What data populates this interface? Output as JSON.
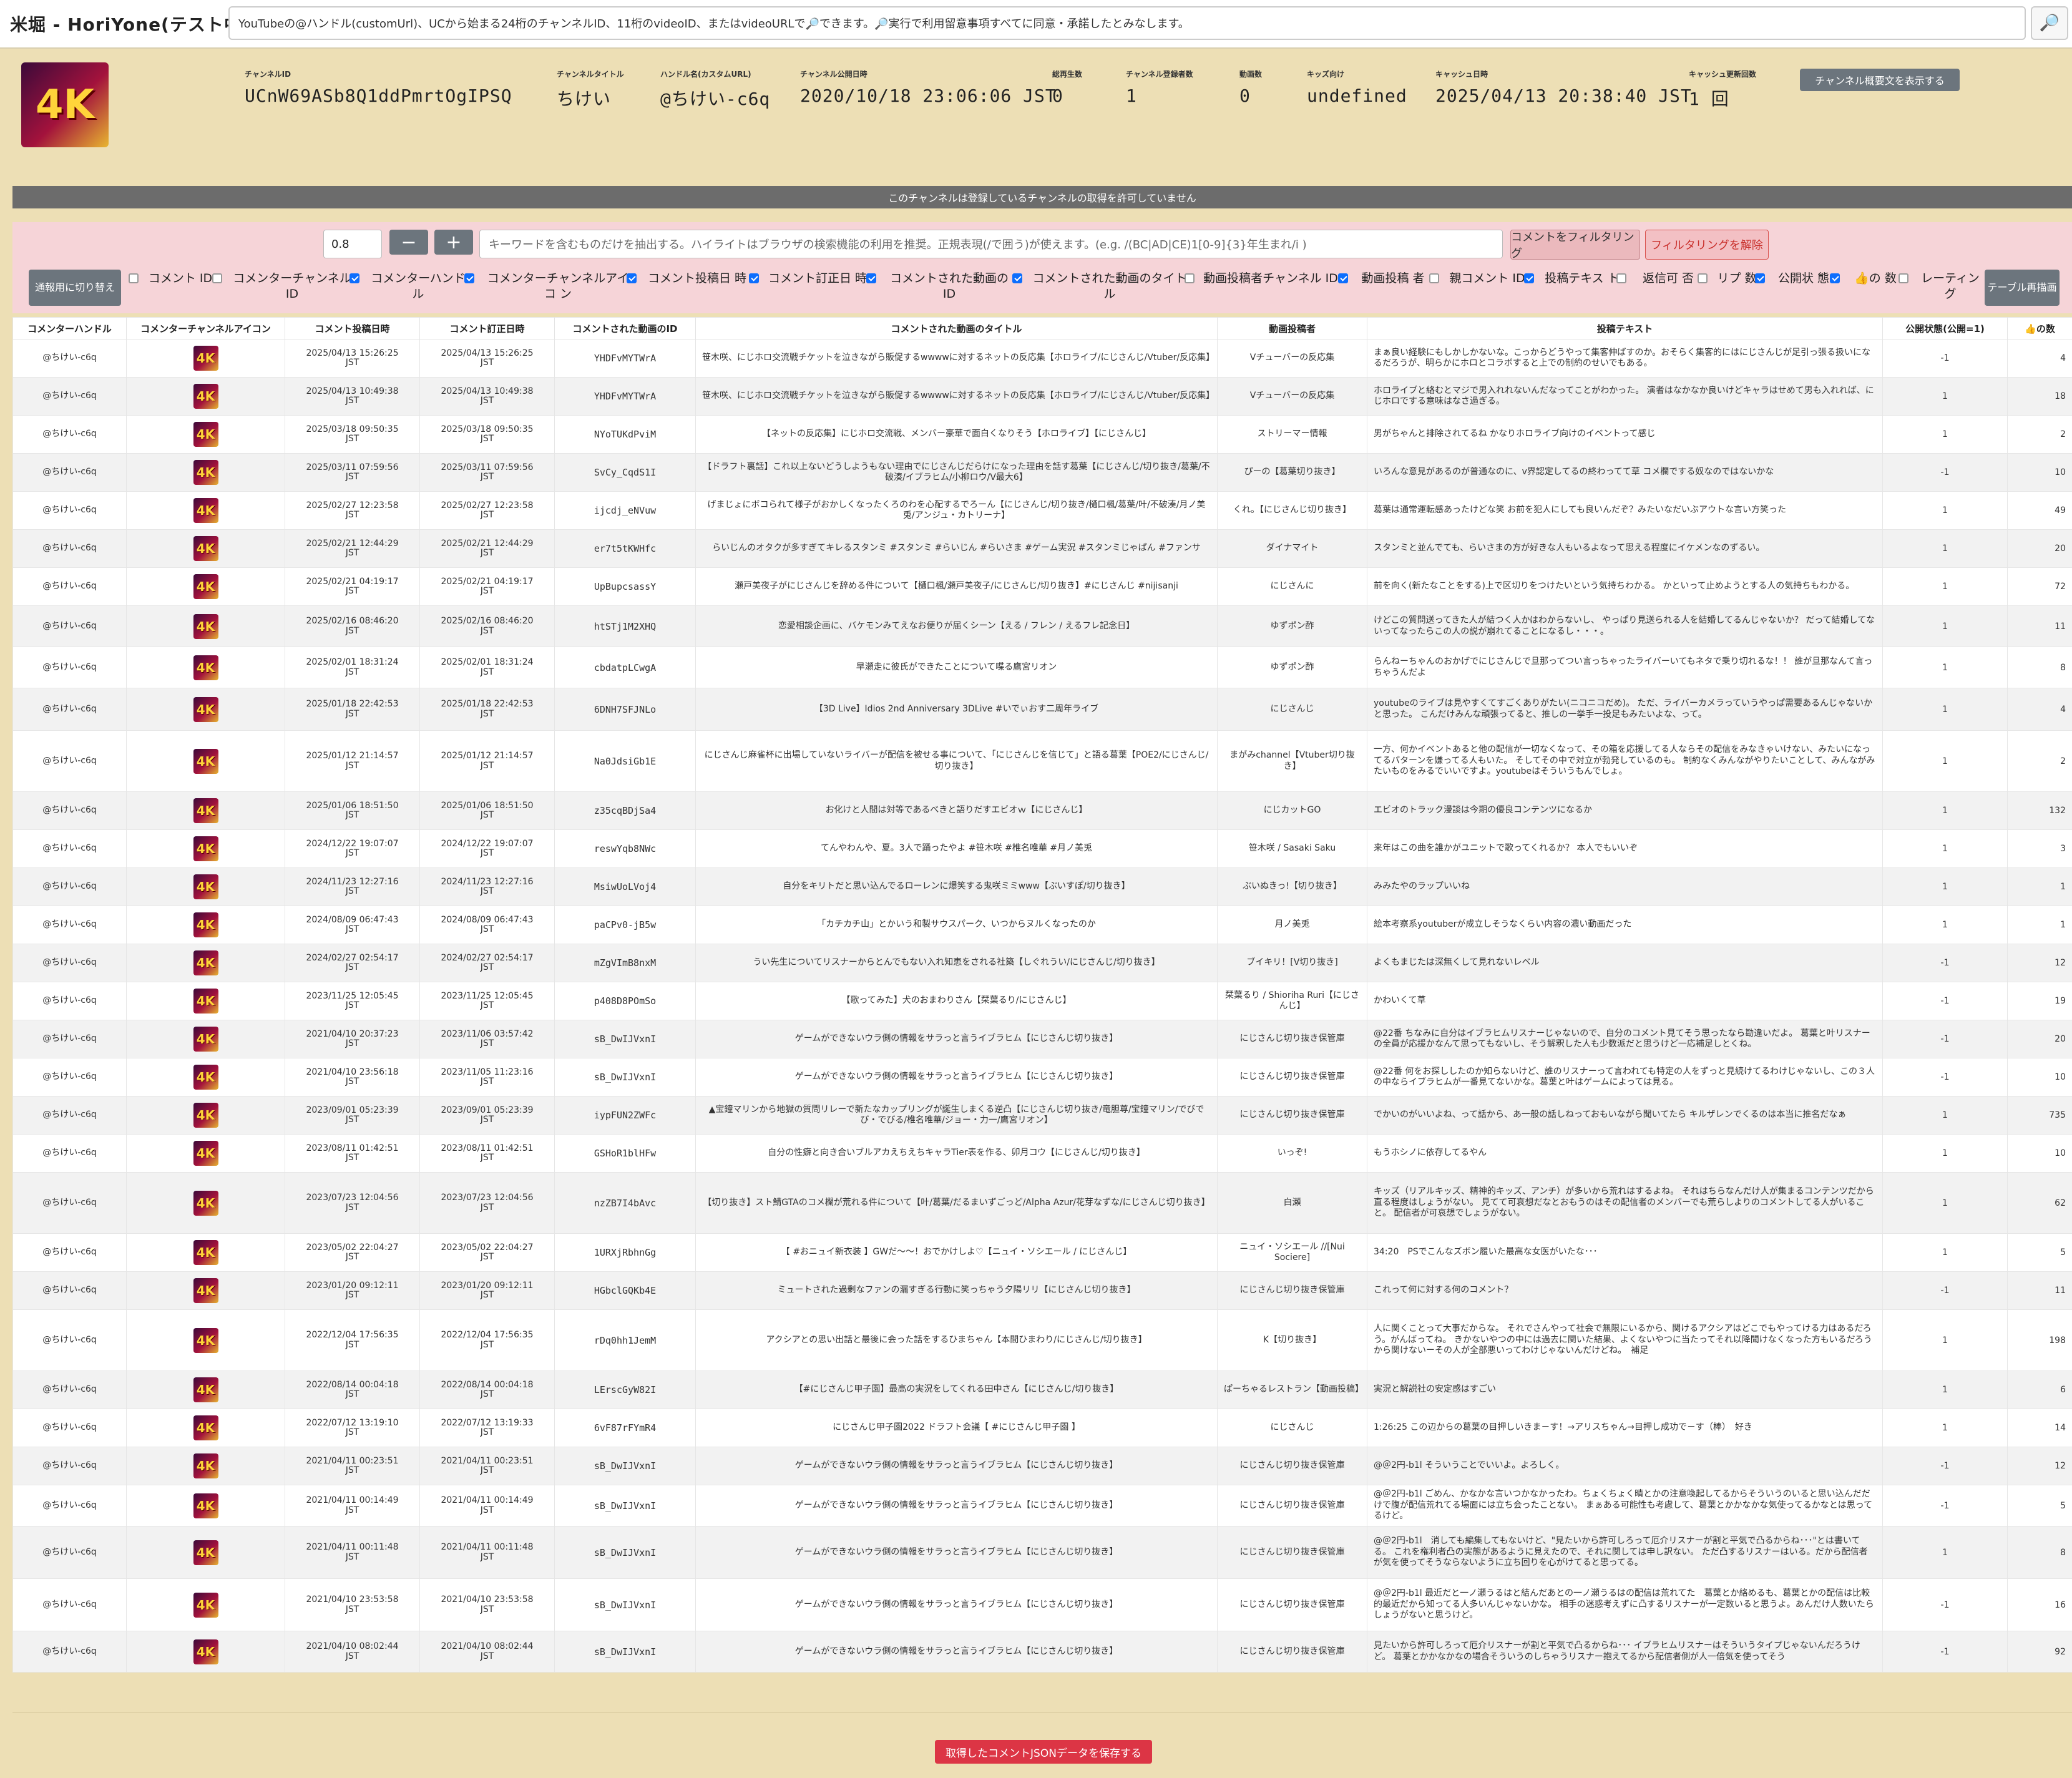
{
  "app": {
    "title": "米堀 - HoriYone(テスト中)"
  },
  "search": {
    "value": "YouTubeの@ハンドル(customUrl)、UCから始まる24桁のチャンネルID、11桁のvideoID、またはvideoURLで🔎できます。🔎実行で利用留意事項すべてに同意・承諾したとみなします。",
    "button_icon": "search-icon"
  },
  "channel": {
    "icon_text": "4K",
    "fields": [
      {
        "label": "チャンネルID",
        "value": "UCnW69ASb8Q1ddPmrtOgIPSQ"
      },
      {
        "label": "チャンネルタイトル",
        "value": "ちけい"
      },
      {
        "label": "ハンドル名(カスタムURL)",
        "value": "@ちけい-c6q"
      },
      {
        "label": "チャンネル公開日時",
        "value": "2020/10/18 23:06:06 JST"
      },
      {
        "label": "総再生数",
        "value": "0"
      },
      {
        "label": "チャンネル登録者数",
        "value": "1"
      },
      {
        "label": "動画数",
        "value": "0"
      },
      {
        "label": "キッズ向け",
        "value": "undefined"
      },
      {
        "label": "キャッシュ日時",
        "value": "2025/04/13 20:38:40 JST"
      },
      {
        "label": "キャッシュ更新回数",
        "value": "1 回"
      }
    ],
    "desc_button": "チャンネル概要文を表示する"
  },
  "notice": "このチャンネルは登録しているチャンネルの取得を許可していません",
  "filter": {
    "threshold": "0.8",
    "minus": "−",
    "plus": "+",
    "placeholder": "キーワードを含むものだけを抽出する。ハイライトはブラウザの検索機能の利用を推奨。正規表現(/で囲う)が使えます。(e.g. /(BC|AD|CE)1[0-9]{3}年生まれ/i )",
    "filter_button": "コメントをフィルタリング",
    "clear_button": "フィルタリングを解除",
    "switch_button": "通報用に切り替え",
    "redraw_button": "テーブル再描画",
    "toggles": [
      {
        "label": "コメント ID",
        "checked": false
      },
      {
        "label": "コメンターチャンネル ID",
        "checked": false
      },
      {
        "label": "コメンターハンド ル",
        "checked": true
      },
      {
        "label": "コメンターチャンネルアイコ ン",
        "checked": true
      },
      {
        "label": "コメント投稿日 時",
        "checked": true
      },
      {
        "label": "コメント訂正日 時",
        "checked": true
      },
      {
        "label": "コメントされた動画の ID",
        "checked": true
      },
      {
        "label": "コメントされた動画のタイト ル",
        "checked": true
      },
      {
        "label": "動画投稿者チャンネル ID",
        "checked": false
      },
      {
        "label": "動画投稿 者",
        "checked": true
      },
      {
        "label": "親コメント ID",
        "checked": false
      },
      {
        "label": "投稿テキス ト",
        "checked": true
      },
      {
        "label": "返信可 否",
        "checked": false
      },
      {
        "label": "リプ 数",
        "checked": false
      },
      {
        "label": "公開状 態",
        "checked": true
      },
      {
        "label": "👍の 数",
        "checked": true
      },
      {
        "label": "レーティン グ",
        "checked": false
      }
    ]
  },
  "table": {
    "headers": [
      "コメンターハンドル",
      "コメンターチャンネルアイコン",
      "コメント投稿日時",
      "コメント訂正日時",
      "コメントされた動画のID",
      "コメントされた動画のタイトル",
      "動画投稿者",
      "投稿テキスト",
      "公開状態(公開=1)",
      "👍の数"
    ],
    "rows": [
      {
        "handle": "@ちけい-c6q",
        "icon": "4K",
        "posted": "2025/04/13 15:26:25",
        "posted_tz": "JST",
        "edited": "2025/04/13 15:26:25",
        "edited_tz": "JST",
        "edited_changed": false,
        "video_id": "YHDFvMYTWrA",
        "title": "笹木咲、にじホロ交流戦チケットを泣きながら販促するwwwwに対するネットの反応集【ホロライブ/にじさんじ/Vtuber/反応集】",
        "uploader": "Vチューバーの反応集",
        "text": "まぁ良い経験にもしかしかないな。こっからどうやって集客伸ばすのか。おそらく集客的にはにじさんじが足引っ張る扱いになるだろうが、明らかにホロとコラボすると上での制約のせいでもある。",
        "status": "-1",
        "likes": "4"
      },
      {
        "handle": "@ちけい-c6q",
        "icon": "4K",
        "posted": "2025/04/13 10:49:38",
        "posted_tz": "JST",
        "edited": "2025/04/13 10:49:38",
        "edited_tz": "JST",
        "edited_changed": false,
        "video_id": "YHDFvMYTWrA",
        "title": "笹木咲、にじホロ交流戦チケットを泣きながら販促するwwwwに対するネットの反応集【ホロライブ/にじさんじ/Vtuber/反応集】",
        "uploader": "Vチューバーの反応集",
        "text": "ホロライブと絡むとマジで男入れれないんだなってことがわかった。 演者はなかなか良いけどキャラはせめて男も入れれば、にじホロでする意味はなさ過ぎる。",
        "status": "1",
        "likes": "18"
      },
      {
        "handle": "@ちけい-c6q",
        "icon": "4K",
        "posted": "2025/03/18 09:50:35",
        "posted_tz": "JST",
        "edited": "2025/03/18 09:50:35",
        "edited_tz": "JST",
        "edited_changed": false,
        "video_id": "NYoTUKdPviM",
        "title": "【ネットの反応集】にじホロ交流戦、メンバー豪華で面白くなりそう【ホロライブ】【にじさんじ】",
        "uploader": "ストリーマー情報",
        "text": "男がちゃんと排除されてるね かなりホロライブ向けのイベントって感じ",
        "status": "1",
        "likes": "2"
      },
      {
        "handle": "@ちけい-c6q",
        "icon": "4K",
        "posted": "2025/03/11 07:59:56",
        "posted_tz": "JST",
        "edited": "2025/03/11 07:59:56",
        "edited_tz": "JST",
        "edited_changed": false,
        "video_id": "SvCy_CqdS1I",
        "title": "【ドラフト裏話】これ以上ないどうしようもない理由でにじさんじだらけになった理由を話す葛葉【にじさんじ/切り抜き/葛葉/不破湊/イブラヒム/小柳ロウ/V最大6】",
        "uploader": "ぴーの【葛葉切り抜き】",
        "text": "いろんな意見があるのが普通なのに、v界認定してるの終わってて草 コメ欄でする奴なのではないかな",
        "status": "-1",
        "likes": "10"
      },
      {
        "handle": "@ちけい-c6q",
        "icon": "4K",
        "posted": "2025/02/27 12:23:58",
        "posted_tz": "JST",
        "edited": "2025/02/27 12:23:58",
        "edited_tz": "JST",
        "edited_changed": false,
        "video_id": "ijcdj_eNVuw",
        "title": "げまじょにボコられて様子がおかしくなったくろのわを心配するでろーん【にじさんじ/切り抜き/樋口楓/葛葉/叶/不破湊/月ノ美兎/アンジュ・カトリーナ】",
        "uploader": "くれ。【にじさんじ切り抜き】",
        "text": "葛葉は通常運転感あったけどな笑 お前を犯人にしても良いんだぞ？みたいなだいぶアウトな言い方笑った",
        "status": "1",
        "likes": "49"
      },
      {
        "handle": "@ちけい-c6q",
        "icon": "4K",
        "posted": "2025/02/21 12:44:29",
        "posted_tz": "JST",
        "edited": "2025/02/21 12:44:29",
        "edited_tz": "JST",
        "edited_changed": false,
        "video_id": "er7t5tKWHfc",
        "title": "らいじんのオタクが多すぎてキレるスタンミ #スタンミ #らいじん #らいさま #ゲーム実況 #スタンミじゃぱん #ファンサ",
        "uploader": "ダイナマイト",
        "text": "スタンミと並んでても、らいさまの方が好きな人もいるよなって思える程度にイケメンなのずるい。",
        "status": "1",
        "likes": "20"
      },
      {
        "handle": "@ちけい-c6q",
        "icon": "4K",
        "posted": "2025/02/21 04:19:17",
        "posted_tz": "JST",
        "edited": "2025/02/21 04:19:17",
        "edited_tz": "JST",
        "edited_changed": false,
        "video_id": "UpBupcsassY",
        "title": "瀬戸美夜子がにじさんじを辞める件について【樋口楓/瀬戸美夜子/にじさんじ/切り抜き】#にじさんじ #nijisanji",
        "uploader": "にじさんに",
        "text": "前を向く(新たなことをする)上で区切りをつけたいという気持ちわかる。 かといって止めようとする人の気持ちもわかる。",
        "status": "1",
        "likes": "72"
      },
      {
        "handle": "@ちけい-c6q",
        "icon": "4K",
        "posted": "2025/02/16 08:46:20",
        "posted_tz": "JST",
        "edited": "2025/02/16 08:46:20",
        "edited_tz": "JST",
        "edited_changed": false,
        "video_id": "htSTj1M2XHQ",
        "title": "恋愛相談企画に、バケモンみてえなお便りが届くシーン【える / フレン / えるフレ記念日】",
        "uploader": "ゆずポン酢",
        "text": "けどこの質問送ってきた人が結つく人かはわからないし、 やっぱり見送られる人を結婚してるんじゃないか？ だって結婚してないってなったらこの人の説が崩れてることになるし・・・。",
        "status": "1",
        "likes": "11"
      },
      {
        "handle": "@ちけい-c6q",
        "icon": "4K",
        "posted": "2025/02/01 18:31:24",
        "posted_tz": "JST",
        "edited": "2025/02/01 18:31:24",
        "edited_tz": "JST",
        "edited_changed": false,
        "video_id": "cbdatpLCwgA",
        "title": "早瀬走に彼氏ができたことについて喋る鷹宮リオン",
        "uploader": "ゆずポン酢",
        "text": "らんねーちゃんのおかげでにじさんじで旦那ってつい言っちゃったライバーいてもネタで乗り切れるな！！ 誰が旦那なんて言っちゃうんだよ",
        "status": "1",
        "likes": "8"
      },
      {
        "handle": "@ちけい-c6q",
        "icon": "4K",
        "posted": "2025/01/18 22:42:53",
        "posted_tz": "JST",
        "edited": "2025/01/18 22:42:53",
        "edited_tz": "JST",
        "edited_changed": false,
        "video_id": "6DNH7SFJNLo",
        "title": "【3D Live】Idios 2nd Anniversary 3DLive #いでぃおす二周年ライブ",
        "uploader": "にじさんじ",
        "text": "youtubeのライブは見やすくてすごくありがたい(ニコニコだめ)。 ただ、ライバーカメラっていうやっぱ需要あるんじゃないかと思った。 こんだけみんな頑張ってると、推しの一挙手一投足もみたいよな、って。",
        "status": "1",
        "likes": "4"
      },
      {
        "handle": "@ちけい-c6q",
        "icon": "4K",
        "posted": "2025/01/12 21:14:57",
        "posted_tz": "JST",
        "edited": "2025/01/12 21:14:57",
        "edited_tz": "JST",
        "edited_changed": false,
        "video_id": "Na0JdsiGb1E",
        "title": "にじさんじ麻雀杯に出場していないライバーが配信を被せる事について、「にじさんじを信じて」と語る葛葉【POE2/にじさんじ/切り抜き】",
        "uploader": "まがみchannel【Vtuber切り抜き】",
        "text": "一方、何かイベントあると他の配信が一切なくなって、その箱を応援してる人ならその配信をみなきゃいけない、みたいになってるパターンを嫌ってる人もいた。 そしてその中で対立が勃発しているのも。 制約なくみんながやりたいことして、みんながみたいものをみるでいいですよ。youtubeはそういうもんでしょ。",
        "status": "1",
        "likes": "2"
      },
      {
        "handle": "@ちけい-c6q",
        "icon": "4K",
        "posted": "2025/01/06 18:51:50",
        "posted_tz": "JST",
        "edited": "2025/01/06 18:51:50",
        "edited_tz": "JST",
        "edited_changed": false,
        "video_id": "z35cqBDjSa4",
        "title": "お化けと人間は対等であるべきと語りだすエビオｗ【にじさんじ】",
        "uploader": "にじカットGO",
        "text": "エビオのトラック漫談は今期の優良コンテンツになるか",
        "status": "1",
        "likes": "132"
      },
      {
        "handle": "@ちけい-c6q",
        "icon": "4K",
        "posted": "2024/12/22 19:07:07",
        "posted_tz": "JST",
        "edited": "2024/12/22 19:07:07",
        "edited_tz": "JST",
        "edited_changed": false,
        "video_id": "reswYqb8NWc",
        "title": "てんやわんや、夏。3人で踊ったやよ #笹木咲 #椎名唯華 #月ノ美兎",
        "uploader": "笹木咲 / Sasaki Saku",
        "text": "来年はこの曲を誰かがユニットで歌ってくれるか？ 本人でもいいぞ",
        "status": "1",
        "likes": "3"
      },
      {
        "handle": "@ちけい-c6q",
        "icon": "4K",
        "posted": "2024/11/23 12:27:16",
        "posted_tz": "JST",
        "edited": "2024/11/23 12:27:16",
        "edited_tz": "JST",
        "edited_changed": false,
        "video_id": "MsiwUoLVoj4",
        "title": "自分をキリトだと思い込んでるローレンに爆笑する鬼咲ミミwww【ぶいすぽ/切り抜き】",
        "uploader": "ぶいぬきっ!【切り抜き】",
        "text": "みみたやのラップいいね",
        "status": "1",
        "likes": "1"
      },
      {
        "handle": "@ちけい-c6q",
        "icon": "4K",
        "posted": "2024/08/09 06:47:43",
        "posted_tz": "JST",
        "edited": "2024/08/09 06:47:43",
        "edited_tz": "JST",
        "edited_changed": false,
        "video_id": "paCPv0-jB5w",
        "title": "「カチカチ山」とかいう和製サウスパーク、いつからヌルくなったのか",
        "uploader": "月ノ美兎",
        "text": "絵本考察系youtuberが成立しそうなくらい内容の濃い動画だった",
        "status": "1",
        "likes": "1"
      },
      {
        "handle": "@ちけい-c6q",
        "icon": "4K",
        "posted": "2024/02/27 02:54:17",
        "posted_tz": "JST",
        "edited": "2024/02/27 02:54:17",
        "edited_tz": "JST",
        "edited_changed": false,
        "video_id": "mZgVImB8nxM",
        "title": "うい先生についてリスナーからとんでもない入れ知恵をされる社築【しぐれうい/にじさんじ/切り抜き】",
        "uploader": "ブイキリ！[V切り抜き]",
        "text": "よくもまじたは深無くして見れないレベル",
        "status": "-1",
        "likes": "12"
      },
      {
        "handle": "@ちけい-c6q",
        "icon": "4K",
        "posted": "2023/11/25 12:05:45",
        "posted_tz": "JST",
        "edited": "2023/11/25 12:05:45",
        "edited_tz": "JST",
        "edited_changed": false,
        "video_id": "p408D8POmSo",
        "title": "【歌ってみた】犬のおまわりさん【栞葉るり/にじさんじ】",
        "uploader": "栞葉るり / Shioriha Ruri【にじさんじ】",
        "text": "かわいくて草",
        "status": "-1",
        "likes": "19"
      },
      {
        "handle": "@ちけい-c6q",
        "icon": "4K",
        "posted": "2021/04/10 20:37:23",
        "posted_tz": "JST",
        "edited": "2023/11/06 03:57:42",
        "edited_tz": "JST",
        "edited_changed": true,
        "video_id": "sB_DwIJVxnI",
        "title": "ゲームができないウラ側の情報をサラっと言うイブラヒム【にじさんじ切り抜き】",
        "uploader": "にじさんじ切り抜き保管庫",
        "text": "@22番 ちなみに自分はイブラヒムリスナーじゃないので、自分のコメント見てそう思ったなら勘違いだよ。 葛葉と叶リスナーの全員が応援かなんて思ってもないし、そう解釈した人も少数派だと思うけど一応補足しとくね。",
        "status": "-1",
        "likes": "20"
      },
      {
        "handle": "@ちけい-c6q",
        "icon": "4K",
        "posted": "2021/04/10 23:56:18",
        "posted_tz": "JST",
        "edited": "2023/11/05 11:23:16",
        "edited_tz": "JST",
        "edited_changed": true,
        "video_id": "sB_DwIJVxnI",
        "title": "ゲームができないウラ側の情報をサラっと言うイブラヒム【にじさんじ切り抜き】",
        "uploader": "にじさんじ切り抜き保管庫",
        "text": "@22番 何をお探ししたのか知らないけど、誰のリスナーって言われても特定の人をずっと見続けてるわけじゃないし、この３人の中ならイブラヒムが一番見てないかな。葛葉と叶はゲームによっては見る。",
        "status": "-1",
        "likes": "10"
      },
      {
        "handle": "@ちけい-c6q",
        "icon": "4K",
        "posted": "2023/09/01 05:23:39",
        "posted_tz": "JST",
        "edited": "2023/09/01 05:23:39",
        "edited_tz": "JST",
        "edited_changed": false,
        "video_id": "iypFUN2ZWFc",
        "title": "▲宝鐘マリンから地獄の質問リレーで新たなカップリングが誕生しまくる逆凸【にじさんじ切り抜き/竜胆尊/宝鐘マリン/でびでび・でびる/椎名唯華/ジョー・力一/鷹宮リオン】",
        "uploader": "にじさんじ切り抜き保管庫",
        "text": "でかいのがいいよね、って話から、あ一般の話しねっておもいながら聞いてたら キルザレンでくるのは本当に推名だなぁ",
        "status": "1",
        "likes": "735"
      },
      {
        "handle": "@ちけい-c6q",
        "icon": "4K",
        "posted": "2023/08/11 01:42:51",
        "posted_tz": "JST",
        "edited": "2023/08/11 01:42:51",
        "edited_tz": "JST",
        "edited_changed": false,
        "video_id": "GSHoR1blHFw",
        "title": "自分の性癖と向き合いブルアカえちえちキャラTier表を作る、卯月コウ【にじさんじ/切り抜き】",
        "uploader": "いっぞ!",
        "text": "もうホシノに依存してるやん",
        "status": "1",
        "likes": "10"
      },
      {
        "handle": "@ちけい-c6q",
        "icon": "4K",
        "posted": "2023/07/23 12:04:56",
        "posted_tz": "JST",
        "edited": "2023/07/23 12:04:56",
        "edited_tz": "JST",
        "edited_changed": false,
        "video_id": "nzZB7I4bAvc",
        "title": "【切り抜き】スト鯖GTAのコメ欄が荒れる件について【叶/葛葉/だるまいずごっど/Alpha Azur/花芽なずな/にじさんじ切り抜き】",
        "uploader": "白瀬",
        "text": "キッズ（リアルキッズ、精神的キッズ、アンチ）が多いから荒れはするよね。 それはちらなんだけ人が集まるコンテンツだから直る程度はしょうがない。 見てて可哀想だなとおもうのはその配信者のメンバーでも荒らしよりのコメントしてる人がいること。 配信者が可哀想でしょうがない。",
        "status": "1",
        "likes": "62"
      },
      {
        "handle": "@ちけい-c6q",
        "icon": "4K",
        "posted": "2023/05/02 22:04:27",
        "posted_tz": "JST",
        "edited": "2023/05/02 22:04:27",
        "edited_tz": "JST",
        "edited_changed": false,
        "video_id": "1URXjRbhnGg",
        "title": "【 #おニュイ新衣装 】GWだ～～！おでかけしよ♡【ニュイ・ソシエール / にじさんじ】",
        "uploader": "ニュイ・ソシエール //[Nui Sociere]",
        "text": "34:20　PSでこんなズボン履いた最高な女医がいたな･･･",
        "status": "1",
        "likes": "5"
      },
      {
        "handle": "@ちけい-c6q",
        "icon": "4K",
        "posted": "2023/01/20 09:12:11",
        "posted_tz": "JST",
        "edited": "2023/01/20 09:12:11",
        "edited_tz": "JST",
        "edited_changed": false,
        "video_id": "HGbclGQKb4E",
        "title": "ミュートされた過剰なファンの漏すぎる行動に笑っちゃう夕陽リリ【にじさんじ切り抜き】",
        "uploader": "にじさんじ切り抜き保管庫",
        "text": "これって何に対する何のコメント？",
        "status": "-1",
        "likes": "11"
      },
      {
        "handle": "@ちけい-c6q",
        "icon": "4K",
        "posted": "2022/12/04 17:56:35",
        "posted_tz": "JST",
        "edited": "2022/12/04 17:56:35",
        "edited_tz": "JST",
        "edited_changed": false,
        "video_id": "rDq0hh1JemM",
        "title": "アクシアとの思い出話と最後に会った話をするひまちゃん【本間ひまわり/にじさんじ/切り抜き】",
        "uploader": "K【切り抜き】",
        "text": "人に関くことって大事だからな。 それでさんやって社会で無限にいるから、関けるアクシアはどこでもやってける力はあるだろう。がんばってね。 きかないやつの中には過去に関いた結果、よくないやつに当たってそれ以降聞けなくなった方もいるだろうから関けないーその人が全部悪いってわけじゃないんだけどね。　補足",
        "status": "1",
        "likes": "198"
      },
      {
        "handle": "@ちけい-c6q",
        "icon": "4K",
        "posted": "2022/08/14 00:04:18",
        "posted_tz": "JST",
        "edited": "2022/08/14 00:04:18",
        "edited_tz": "JST",
        "edited_changed": false,
        "video_id": "LErscGyW82I",
        "title": "【#にじさんじ甲子園】最高の実況をしてくれる田中さん【にじさんじ/切り抜き】",
        "uploader": "ぱーちゃるレストラン【動画投稿】",
        "text": "実況と解説社の安定感はすごい",
        "status": "1",
        "likes": "6"
      },
      {
        "handle": "@ちけい-c6q",
        "icon": "4K",
        "posted": "2022/07/12 13:19:10",
        "posted_tz": "JST",
        "edited": "2022/07/12 13:19:33",
        "edited_tz": "JST",
        "edited_changed": true,
        "video_id": "6vF87rFYmR4",
        "title": "にじさんじ甲子園2022 ドラフト会議【 #にじさんじ甲子園 】",
        "uploader": "にじさんじ",
        "text": "1:26:25 この辺からの葛葉の目押しいきま－す！→アリスちゃん→目押し成功で－す（棒）　好き",
        "status": "1",
        "likes": "14"
      },
      {
        "handle": "@ちけい-c6q",
        "icon": "4K",
        "posted": "2021/04/11 00:23:51",
        "posted_tz": "JST",
        "edited": "2021/04/11 00:23:51",
        "edited_tz": "JST",
        "edited_changed": false,
        "video_id": "sB_DwIJVxnI",
        "title": "ゲームができないウラ側の情報をサラっと言うイブラヒム【にじさんじ切り抜き】",
        "uploader": "にじさんじ切り抜き保管庫",
        "text": "@＠2円-b1l そういうことでいいよ。よろしく。",
        "status": "-1",
        "likes": "12"
      },
      {
        "handle": "@ちけい-c6q",
        "icon": "4K",
        "posted": "2021/04/11 00:14:49",
        "posted_tz": "JST",
        "edited": "2021/04/11 00:14:49",
        "edited_tz": "JST",
        "edited_changed": false,
        "video_id": "sB_DwIJVxnI",
        "title": "ゲームができないウラ側の情報をサラっと言うイブラヒム【にじさんじ切り抜き】",
        "uploader": "にじさんじ切り抜き保管庫",
        "text": "@＠2円-b1l ごめん、かなかな言いつかなかったわ。ちょくちょく晴とかの注意喚起してるからそういうのいると思い込んだだけで腹が配信荒れてる場面には立ち会ったことない。 まぁある可能性も考慮して、葛葉とかかなかな気使ってるかなとは思ってるけど。",
        "status": "-1",
        "likes": "5"
      },
      {
        "handle": "@ちけい-c6q",
        "icon": "4K",
        "posted": "2021/04/11 00:11:48",
        "posted_tz": "JST",
        "edited": "2021/04/11 00:11:48",
        "edited_tz": "JST",
        "edited_changed": false,
        "video_id": "sB_DwIJVxnI",
        "title": "ゲームができないウラ側の情報をサラっと言うイブラヒム【にじさんじ切り抜き】",
        "uploader": "にじさんじ切り抜き保管庫",
        "text": "@＠2円-b1l　消しても編集してもないけど、\"見たいから許可しろって厄介リスナーが割と平気で凸るからね･･･\"とは書いてる。 これを権利者凸の実態があるように見えたので、それに関しては申し訳ない。 ただ凸するリスナーはいる。だから配信者が気を使ってそうならないように立ち回りを心がけてると思ってる。",
        "status": "1",
        "likes": "8"
      },
      {
        "handle": "@ちけい-c6q",
        "icon": "4K",
        "posted": "2021/04/10 23:53:58",
        "posted_tz": "JST",
        "edited": "2021/04/10 23:53:58",
        "edited_tz": "JST",
        "edited_changed": false,
        "video_id": "sB_DwIJVxnI",
        "title": "ゲームができないウラ側の情報をサラっと言うイブラヒム【にじさんじ切り抜き】",
        "uploader": "にじさんじ切り抜き保管庫",
        "text": "@＠2円-b1l 最近だと一ノ瀬うるはと結んだあとの一ノ瀬うるはの配信は荒れてた　葛葉とか絡めるも、葛葉とかの配信は比較的最近だから知ってる人多いんじゃないかな。 相手の迷惑考えずに凸するリスナーが一定数いると思うよ。あんだけ人数いたらしょうがないと思うけど。",
        "status": "-1",
        "likes": "16"
      },
      {
        "handle": "@ちけい-c6q",
        "icon": "4K",
        "posted": "2021/04/10 08:02:44",
        "posted_tz": "JST",
        "edited": "2021/04/10 08:02:44",
        "edited_tz": "JST",
        "edited_changed": false,
        "video_id": "sB_DwIJVxnI",
        "title": "ゲームができないウラ側の情報をサラっと言うイブラヒム【にじさんじ切り抜き】",
        "uploader": "にじさんじ切り抜き保管庫",
        "text": "見たいから許可しろって厄介リスナーが割と平気で凸るからね･･･ イブラヒムリスナーはそういうタイプじゃないんだろうけど。 葛葉とかかなかなの場合そういうのしちゃうリスナー抱えてるから配信者側が人一倍気を使ってそう",
        "status": "-1",
        "likes": "92"
      }
    ]
  },
  "footer": {
    "save_button": "取得したコメントJSONデータを保存する"
  }
}
